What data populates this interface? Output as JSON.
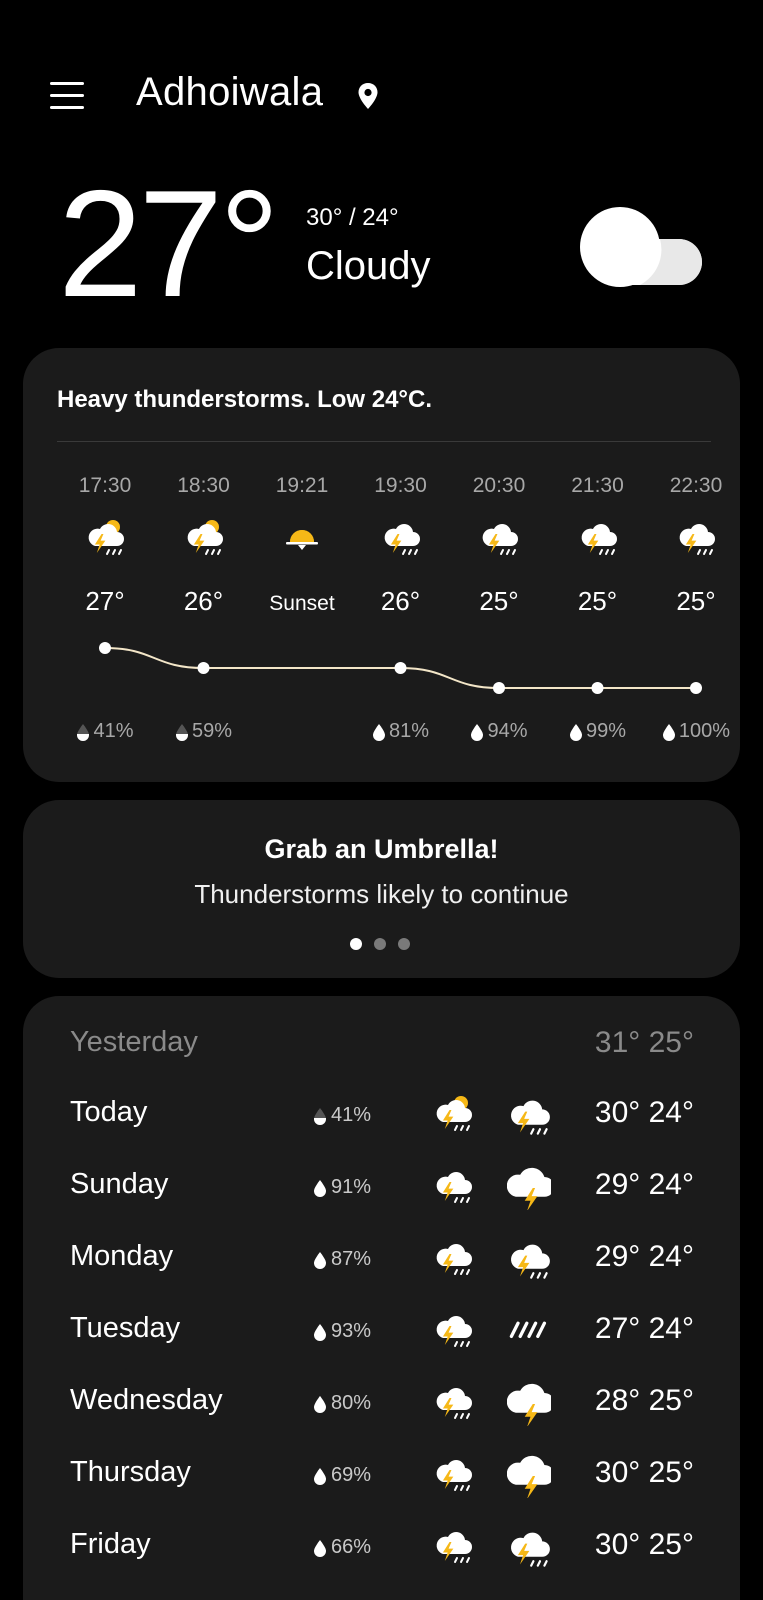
{
  "header": {
    "location": "Adhoiwala",
    "menu_icon": "menu-icon",
    "pin_icon": "location-pin-icon"
  },
  "current": {
    "temp": "27°",
    "hilo": "30° / 24°",
    "condition": "Cloudy",
    "icon": "cloud-icon"
  },
  "hourly": {
    "summary": "Heavy thunderstorms. Low 24°C.",
    "items": [
      {
        "time": "17:30",
        "temp": "27°",
        "precip": "41%",
        "icon": "thunderstorm-sun-icon",
        "drop": "half"
      },
      {
        "time": "18:30",
        "temp": "26°",
        "precip": "59%",
        "icon": "thunderstorm-sun-icon",
        "drop": "half"
      },
      {
        "time": "19:21",
        "temp": "Sunset",
        "precip": "",
        "icon": "sunset-icon",
        "drop": "none"
      },
      {
        "time": "19:30",
        "temp": "26°",
        "precip": "81%",
        "icon": "thunderstorm-icon",
        "drop": "full"
      },
      {
        "time": "20:30",
        "temp": "25°",
        "precip": "94%",
        "icon": "thunderstorm-icon",
        "drop": "full"
      },
      {
        "time": "21:30",
        "temp": "25°",
        "precip": "99%",
        "icon": "thunderstorm-icon",
        "drop": "full"
      },
      {
        "time": "22:30",
        "temp": "25°",
        "precip": "100%",
        "icon": "thunderstorm-icon",
        "drop": "full"
      }
    ],
    "trend_values": [
      27,
      26,
      26,
      26,
      25,
      25,
      25
    ]
  },
  "tip": {
    "title": "Grab an Umbrella!",
    "subtitle": "Thunderstorms likely to continue",
    "page_count": 3,
    "active_page": 1
  },
  "daily": {
    "yesterday": {
      "label": "Yesterday",
      "temps": "31° 25°"
    },
    "days": [
      {
        "name": "Today",
        "precip": "41%",
        "drop": "half",
        "icon_day": "thunderstorm-sun-icon",
        "icon_night": "thunderstorm-icon",
        "temps": "30° 24°"
      },
      {
        "name": "Sunday",
        "precip": "91%",
        "drop": "full",
        "icon_day": "thunderstorm-icon",
        "icon_night": "lightning-cloud-icon",
        "temps": "29° 24°"
      },
      {
        "name": "Monday",
        "precip": "87%",
        "drop": "full",
        "icon_day": "thunderstorm-icon",
        "icon_night": "thunderstorm-icon",
        "temps": "29° 24°"
      },
      {
        "name": "Tuesday",
        "precip": "93%",
        "drop": "full",
        "icon_day": "thunderstorm-icon",
        "icon_night": "rain-icon",
        "temps": "27° 24°"
      },
      {
        "name": "Wednesday",
        "precip": "80%",
        "drop": "full",
        "icon_day": "thunderstorm-icon",
        "icon_night": "lightning-cloud-icon",
        "temps": "28° 25°"
      },
      {
        "name": "Thursday",
        "precip": "69%",
        "drop": "full",
        "icon_day": "thunderstorm-icon",
        "icon_night": "lightning-cloud-icon",
        "temps": "30° 25°"
      },
      {
        "name": "Friday",
        "precip": "66%",
        "drop": "full",
        "icon_day": "thunderstorm-icon",
        "icon_night": "thunderstorm-icon",
        "temps": "30° 25°"
      }
    ]
  }
}
